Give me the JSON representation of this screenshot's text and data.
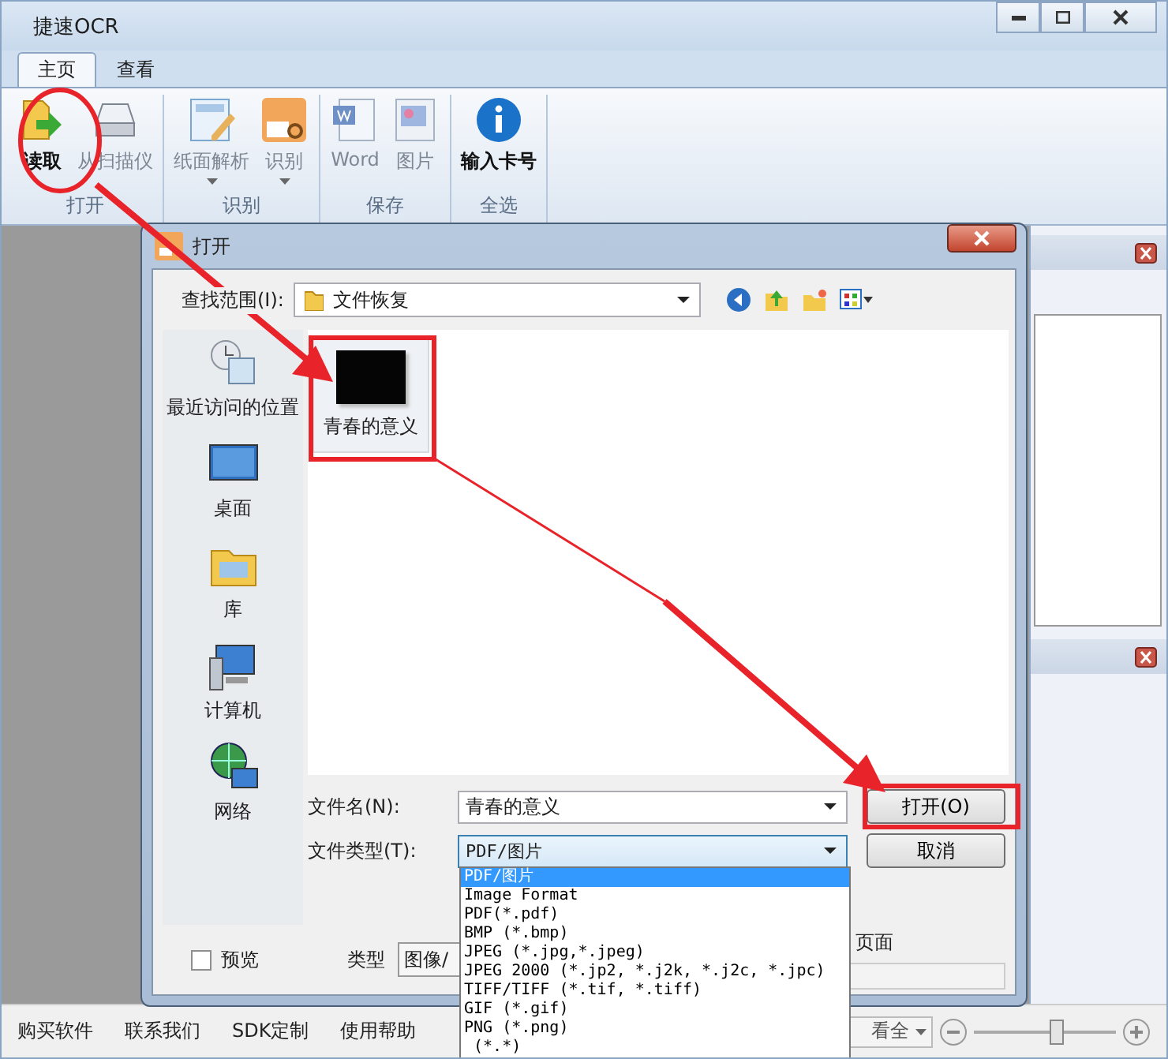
{
  "window": {
    "title": "捷速OCR"
  },
  "ribbon": {
    "tabs": [
      {
        "label": "主页",
        "selected": true
      },
      {
        "label": "查看",
        "selected": false
      }
    ],
    "groups": [
      {
        "label": "打开",
        "buttons": [
          {
            "kind": "open",
            "label": "读取",
            "disabled": false,
            "dropdown": false
          },
          {
            "kind": "scanner",
            "label": "从扫描仪",
            "disabled": true,
            "dropdown": false
          }
        ]
      },
      {
        "label": "识别",
        "buttons": [
          {
            "kind": "layout",
            "label": "纸面解析",
            "disabled": true,
            "dropdown": true
          },
          {
            "kind": "ocr",
            "label": "识别",
            "disabled": true,
            "dropdown": true
          }
        ]
      },
      {
        "label": "保存",
        "buttons": [
          {
            "kind": "word",
            "label": "Word",
            "disabled": true,
            "dropdown": false
          },
          {
            "kind": "image",
            "label": "图片",
            "disabled": true,
            "dropdown": false
          }
        ]
      },
      {
        "label": "全选",
        "buttons": [
          {
            "kind": "info",
            "label": "输入卡号",
            "disabled": false,
            "dropdown": false
          }
        ]
      }
    ]
  },
  "dialog": {
    "title": "打开",
    "look_in_label": "查找范围(I):",
    "look_in_value": "文件恢复",
    "places": [
      {
        "kind": "recent",
        "label": "最近访问的位置"
      },
      {
        "kind": "desktop",
        "label": "桌面"
      },
      {
        "kind": "library",
        "label": "库"
      },
      {
        "kind": "computer",
        "label": "计算机"
      },
      {
        "kind": "network",
        "label": "网络"
      }
    ],
    "files": [
      {
        "name": "青春的意义",
        "selected": true
      }
    ],
    "filename_label": "文件名(N):",
    "filename_value": "青春的意义",
    "filetype_label": "文件类型(T):",
    "filetype_value": "PDF/图片",
    "open_button": "打开(O)",
    "cancel_button": "取消",
    "preview": {
      "label": "预览",
      "checked": false
    },
    "type_label": "类型",
    "type_value": "图像/",
    "pages_text": "页面",
    "filetype_options": [
      {
        "label": "PDF/图片",
        "selected": true
      },
      {
        "label": "Image Format",
        "selected": false
      },
      {
        "label": "PDF(*.pdf)",
        "selected": false
      },
      {
        "label": "BMP (*.bmp)",
        "selected": false
      },
      {
        "label": "JPEG (*.jpg,*.jpeg)",
        "selected": false
      },
      {
        "label": "JPEG 2000 (*.jp2, *.j2k, *.j2c, *.jpc)",
        "selected": false
      },
      {
        "label": "TIFF/TIFF (*.tif, *.tiff)",
        "selected": false
      },
      {
        "label": "GIF (*.gif)",
        "selected": false
      },
      {
        "label": "PNG (*.png)",
        "selected": false
      },
      {
        "label": " (*.*)",
        "selected": false
      }
    ]
  },
  "status_bar": {
    "links": [
      "购买软件",
      "联系我们",
      "SDK定制",
      "使用帮助"
    ],
    "zoom_mode": "看全",
    "zoom": {
      "level": 0.58
    }
  }
}
